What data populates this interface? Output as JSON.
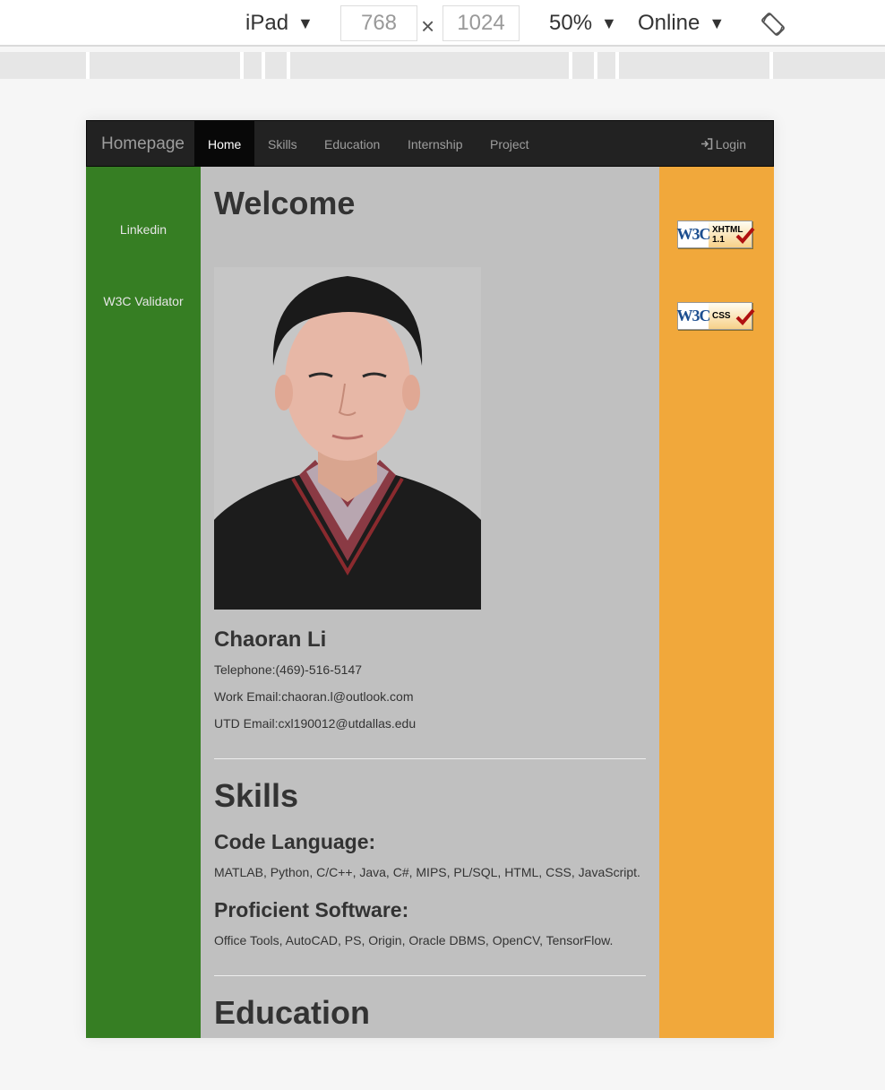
{
  "devtools": {
    "device": "iPad",
    "width": "768",
    "height": "1024",
    "times": "×",
    "zoom": "50%",
    "network": "Online",
    "caret": "▼"
  },
  "navbar": {
    "brand": "Homepage",
    "items": [
      {
        "label": "Home",
        "active": true
      },
      {
        "label": "Skills"
      },
      {
        "label": "Education"
      },
      {
        "label": "Internship"
      },
      {
        "label": "Project"
      }
    ],
    "login": "Login"
  },
  "sidebar": {
    "links": [
      "Linkedin",
      "W3C Validator"
    ]
  },
  "main": {
    "welcome": "Welcome",
    "name": "Chaoran Li",
    "telephone": "Telephone:(469)-516-5147",
    "work_email": "Work Email:chaoran.l@outlook.com",
    "utd_email": "UTD Email:cxl190012@utdallas.edu",
    "skills_title": "Skills",
    "code_title": "Code Language:",
    "code_text": "MATLAB, Python, C/C++, Java, C#, MIPS, PL/SQL, HTML, CSS, JavaScript.",
    "software_title": "Proficient Software:",
    "software_text": "Office Tools, AutoCAD, PS, Origin, Oracle DBMS, OpenCV, TensorFlow.",
    "education_title": "Education"
  },
  "badges": {
    "w3c": "W3C",
    "xhtml": [
      "XHTML",
      "1.1"
    ],
    "css": "CSS"
  },
  "colors": {
    "navbar": "#222222",
    "left": "#367e23",
    "main": "#c0c0c0",
    "right": "#f1a83b"
  }
}
